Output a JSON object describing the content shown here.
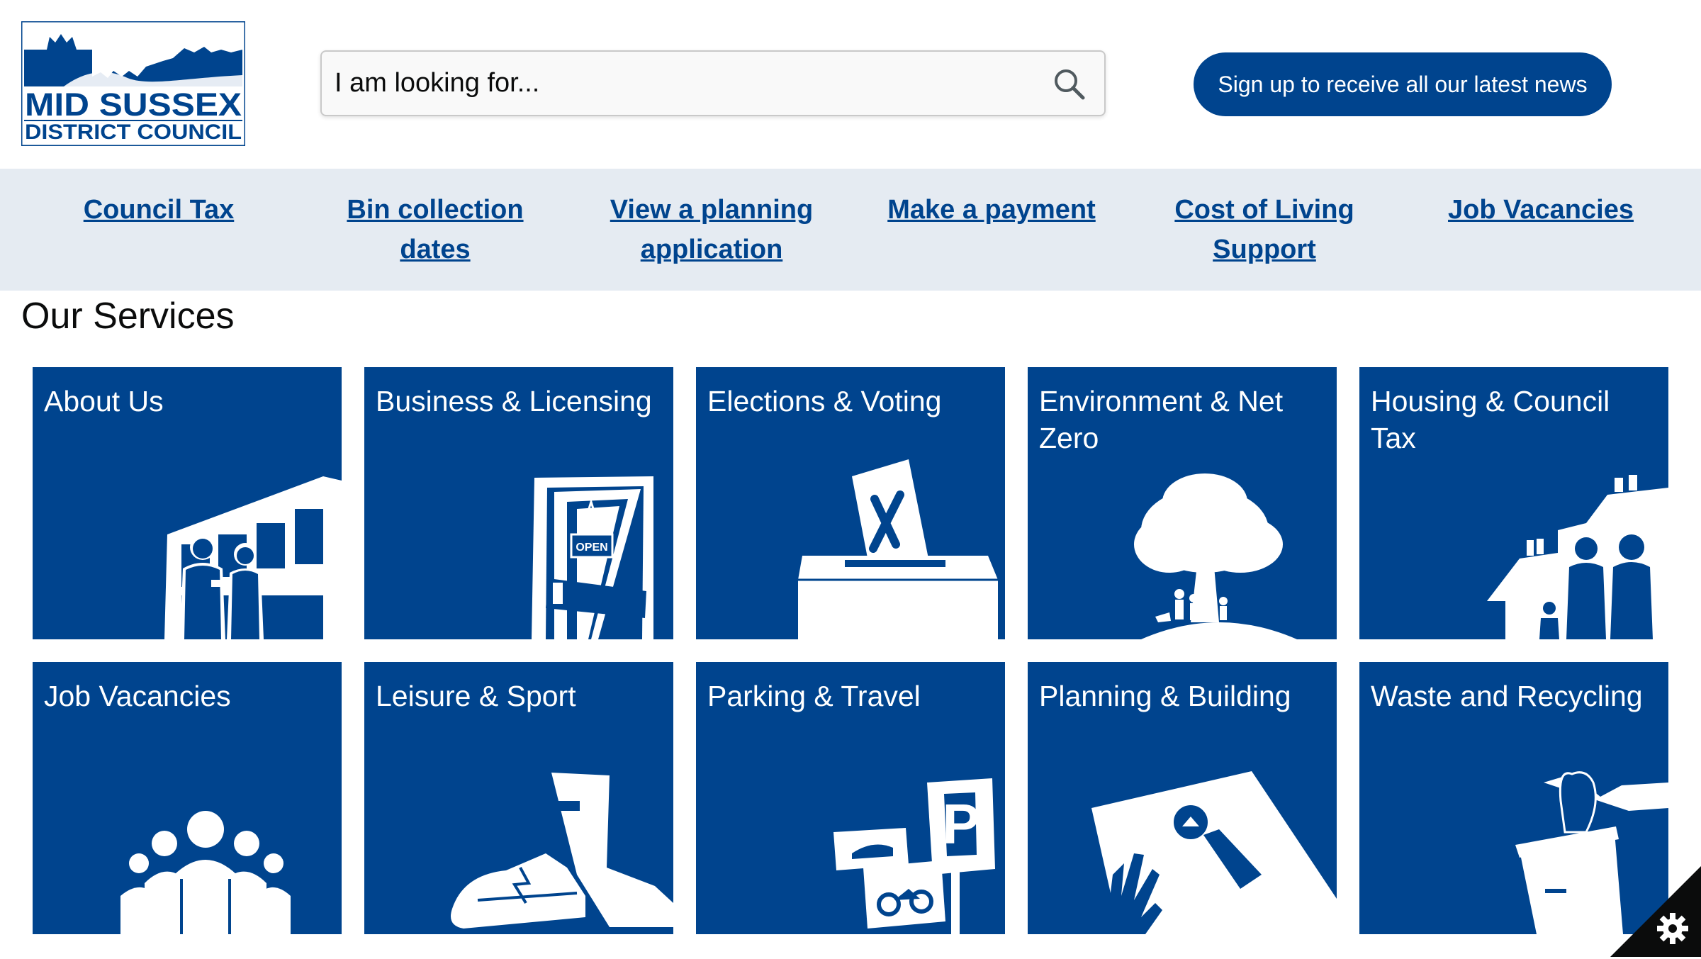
{
  "header": {
    "logo": {
      "line1": "MID SUSSEX",
      "line2": "DISTRICT COUNCIL"
    },
    "search": {
      "placeholder": "I am looking for...",
      "icon": "search-icon"
    },
    "signup_label": "Sign up to receive all our latest news"
  },
  "quick_links": [
    {
      "label": "Council Tax"
    },
    {
      "label": "Bin collection dates"
    },
    {
      "label": "View a planning application"
    },
    {
      "label": "Make a payment"
    },
    {
      "label": "Cost of Living Support"
    },
    {
      "label": "Job Vacancies"
    }
  ],
  "services": {
    "title": "Our Services",
    "tiles": [
      {
        "label": "About Us",
        "icon": "council-office-icon"
      },
      {
        "label": "Business & Licensing",
        "icon": "shop-door-open-sign-icon"
      },
      {
        "label": "Elections & Voting",
        "icon": "ballot-box-icon"
      },
      {
        "label": "Environment & Net Zero",
        "icon": "tree-family-icon"
      },
      {
        "label": "Housing & Council Tax",
        "icon": "houses-family-icon"
      },
      {
        "label": "Job Vacancies",
        "icon": "people-group-icon"
      },
      {
        "label": "Leisure & Sport",
        "icon": "boot-trainer-icon"
      },
      {
        "label": "Parking & Travel",
        "icon": "parking-signs-icon"
      },
      {
        "label": "Planning & Building",
        "icon": "plan-magnifier-icon"
      },
      {
        "label": "Waste and Recycling",
        "icon": "recycling-bin-icon"
      }
    ]
  },
  "cookie_settings": {
    "icon": "gear-icon"
  },
  "colors": {
    "brand_blue": "#00448e",
    "quicklinks_bg": "#e5ebf2",
    "text": "#0b0c0c"
  }
}
